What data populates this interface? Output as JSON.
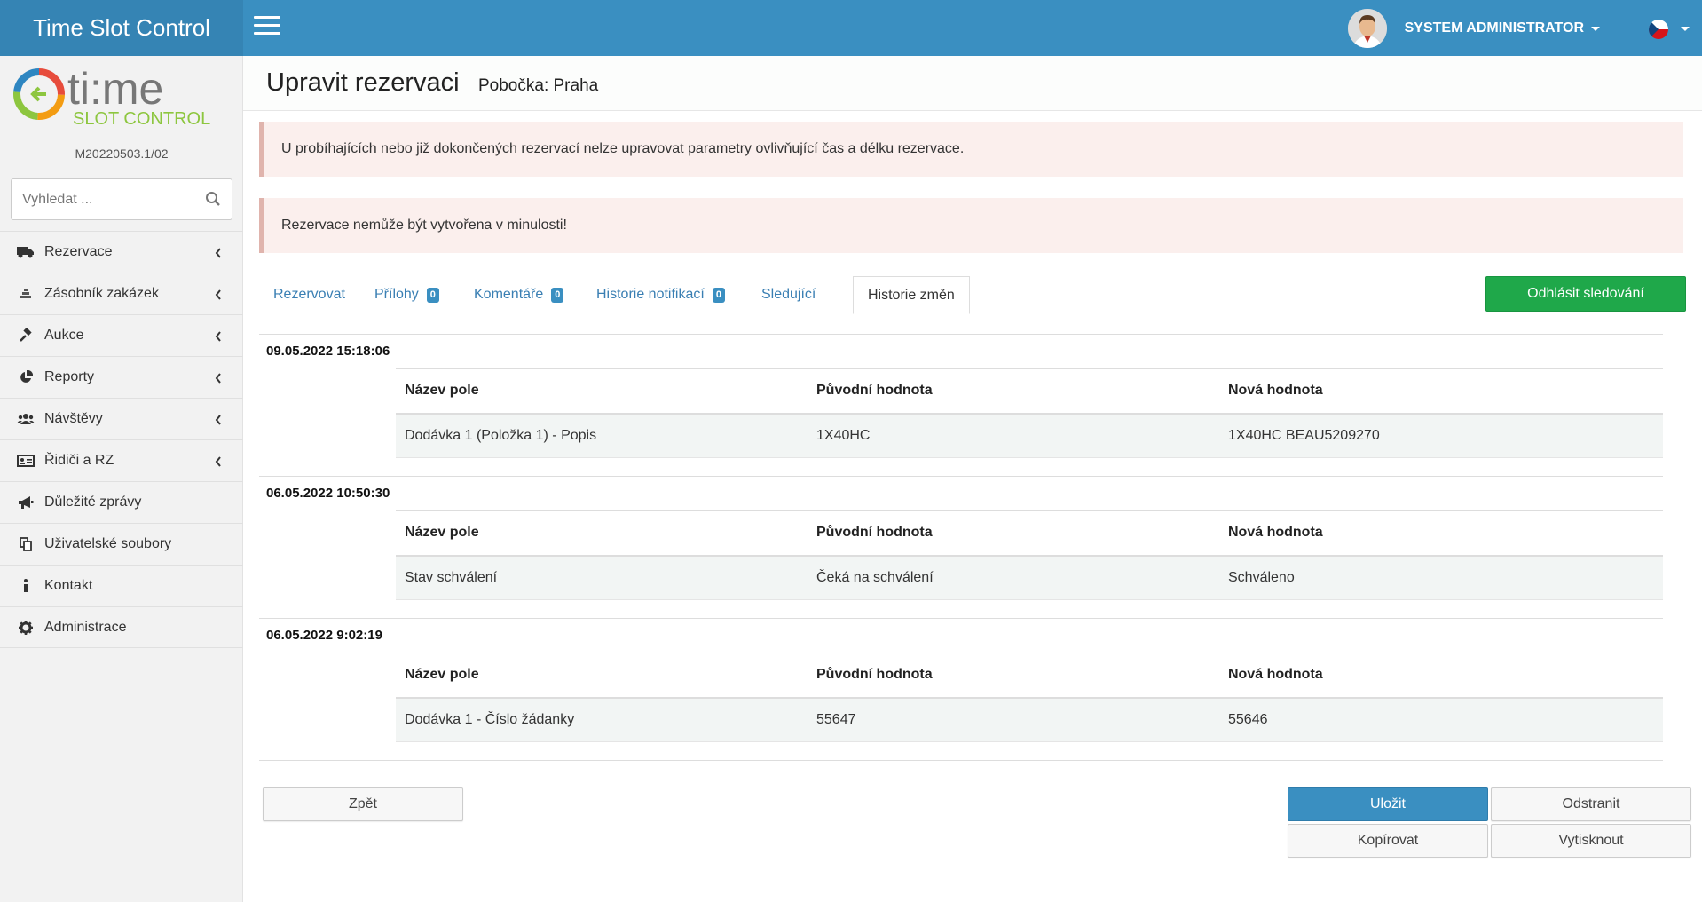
{
  "app": {
    "title": "Time Slot Control",
    "version": "M20220503.1/02"
  },
  "topbar": {
    "user_name": "SYSTEM ADMINISTRATOR",
    "flag": "cz-flag"
  },
  "search": {
    "placeholder": "Vyhledat ..."
  },
  "sidebar": {
    "items": [
      {
        "label": "Rezervace",
        "icon": "truck-icon",
        "has_chevron": true
      },
      {
        "label": "Zásobník zakázek",
        "icon": "stack-icon",
        "has_chevron": true
      },
      {
        "label": "Aukce",
        "icon": "gavel-icon",
        "has_chevron": true
      },
      {
        "label": "Reporty",
        "icon": "pie-chart-icon",
        "has_chevron": true
      },
      {
        "label": "Návštěvy",
        "icon": "users-icon",
        "has_chevron": true
      },
      {
        "label": "Řidiči a RZ",
        "icon": "id-card-icon",
        "has_chevron": true
      },
      {
        "label": "Důležité zprávy",
        "icon": "megaphone-icon",
        "has_chevron": false
      },
      {
        "label": "Uživatelské soubory",
        "icon": "copy-icon",
        "has_chevron": false
      },
      {
        "label": "Kontakt",
        "icon": "info-icon",
        "has_chevron": false
      },
      {
        "label": "Administrace",
        "icon": "gear-icon",
        "has_chevron": false
      }
    ]
  },
  "header": {
    "title": "Upravit rezervaci",
    "subtitle": "Pobočka: Praha"
  },
  "alerts": [
    "U probíhajících nebo již dokončených rezervací nelze upravovat parametry ovlivňující čas a délku rezervace.",
    "Rezervace nemůže být vytvořena v minulosti!"
  ],
  "tabs": [
    {
      "label": "Rezervovat"
    },
    {
      "label": "Přílohy",
      "badge": "0"
    },
    {
      "label": "Komentáře",
      "badge": "0"
    },
    {
      "label": "Historie notifikací",
      "badge": "0"
    },
    {
      "label": "Sledující"
    },
    {
      "label": "Historie změn",
      "active": true
    }
  ],
  "unfollow_button": "Odhlásit sledování",
  "history": {
    "columns": [
      "Název pole",
      "Původní hodnota",
      "Nová hodnota"
    ],
    "entries": [
      {
        "date": "09.05.2022 15:18:06",
        "rows": [
          [
            "Dodávka 1 (Položka 1) - Popis",
            "1X40HC",
            "1X40HC BEAU5209270"
          ]
        ]
      },
      {
        "date": "06.05.2022 10:50:30",
        "rows": [
          [
            "Stav schválení",
            "Čeká na schválení",
            "Schváleno"
          ]
        ]
      },
      {
        "date": "06.05.2022 9:02:19",
        "rows": [
          [
            "Dodávka 1 - Číslo žádanky",
            "55647",
            "55646"
          ]
        ]
      }
    ]
  },
  "buttons": {
    "back": "Zpět",
    "save": "Uložit",
    "delete": "Odstranit",
    "copy": "Kopírovat",
    "print": "Vytisknout"
  },
  "colors": {
    "primary": "#3a8fc1",
    "success": "#1fa84a",
    "alert_bg": "#fbefed"
  }
}
